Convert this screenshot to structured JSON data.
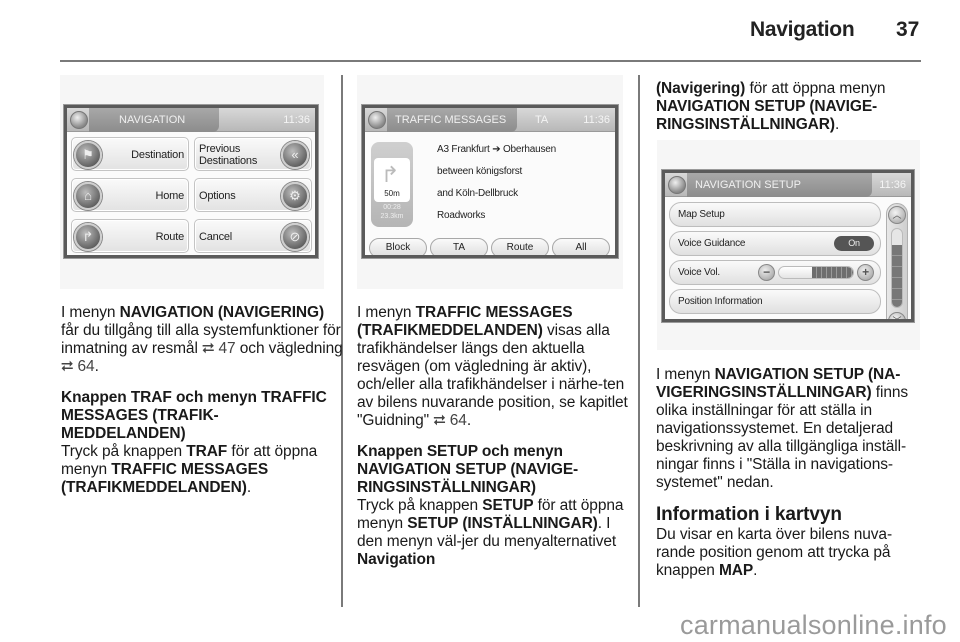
{
  "header": {
    "title": "Navigation",
    "page_number": "37"
  },
  "figures": {
    "navigation": {
      "title": "NAVIGATION",
      "time": "11:36",
      "buttons": [
        {
          "label": "Destination",
          "icon": "checkered-flag-icon"
        },
        {
          "label": "Previous Destinations",
          "icon": "rewind-flag-icon"
        },
        {
          "label": "Home",
          "icon": "home-icon"
        },
        {
          "label": "Options",
          "icon": "gears-icon"
        },
        {
          "label": "Route",
          "icon": "route-signpost-icon"
        },
        {
          "label": "Cancel",
          "icon": "cancel-route-icon"
        }
      ]
    },
    "traffic": {
      "title": "TRAFFIC MESSAGES",
      "ta": "TA",
      "time": "11:36",
      "turn_distance": "50m",
      "eta": "00:28",
      "remaining": "23.3km",
      "lines": [
        "A3 Frankfurt ➔ Oberhausen",
        "between königsforst",
        "and Köln-Dellbruck",
        "Roadworks"
      ],
      "buttons": [
        "Block",
        "TA",
        "Route",
        "All"
      ]
    },
    "setup": {
      "title": "NAVIGATION SETUP",
      "time": "11:36",
      "rows": [
        "Map Setup",
        "Voice Guidance",
        "Voice Vol.",
        "Position Information"
      ],
      "voice_guidance_state": "On",
      "voice_volume_fraction": 0.55,
      "scroll_position_fraction": 0.4
    }
  },
  "columns": {
    "col1": {
      "p1": {
        "a": "I menyn ",
        "b": "NAVIGATION (NAVIGERING)",
        "c": " får du tillgång till alla systemfunktioner för inmatning av resmål ",
        "ref1": "⮂ 47",
        "d": " och vägledning ",
        "ref2": "⮂ 64",
        "e": "."
      },
      "h1": "Knappen TRAF och menyn TRAFFIC MESSAGES (TRAFIK-MEDDELANDEN)",
      "p2": {
        "a": "Tryck på knappen ",
        "b": "TRAF",
        "c": " för att öppna menyn ",
        "d": "TRAFFIC MESSAGES (TRAFIKMEDDELANDEN)",
        "e": "."
      }
    },
    "col2": {
      "p1": {
        "a": "I menyn ",
        "b": "TRAFFIC MESSAGES (TRAFIKMEDDELANDEN)",
        "c": " visas alla trafikhändelser längs den aktuella resvägen (om vägledning är aktiv), och/eller alla trafikhändelser i närhe-ten av bilens nuvarande position, se kapitlet \"Guidning\" ",
        "ref": "⮂ 64",
        "d": "."
      },
      "h1": "Knappen SETUP och menyn NAVIGATION SETUP (NAVIGE-RINGSINSTÄLLNINGAR)",
      "p2": {
        "a": "Tryck på knappen ",
        "b": "SETUP",
        "c": " för att öppna menyn ",
        "d": "SETUP (INSTÄLLNINGAR)",
        "e": ". I den menyn väl-jer du menyalternativet ",
        "f": "Navigation"
      }
    },
    "col3": {
      "p0": {
        "a": "(Navigering)",
        "b": " för att öppna menyn ",
        "c": "NAVIGATION SETUP (NAVIGE-RINGSINSTÄLLNINGAR)",
        "d": "."
      },
      "p1": {
        "a": "I menyn ",
        "b": "NAVIGATION SETUP (NA-VIGERINGSINSTÄLLNINGAR)",
        "c": " finns olika inställningar för att ställa in navigationssystemet. En detaljerad beskrivning av alla tillgängliga inställ-ningar finns i \"Ställa in navigations-systemet\" nedan."
      },
      "h1": "Information i kartvyn",
      "p2": {
        "a": "Du visar en karta över bilens nuva-rande position genom att trycka på knappen ",
        "b": "MAP",
        "c": "."
      }
    }
  },
  "watermark": "carmanualsonline.info"
}
